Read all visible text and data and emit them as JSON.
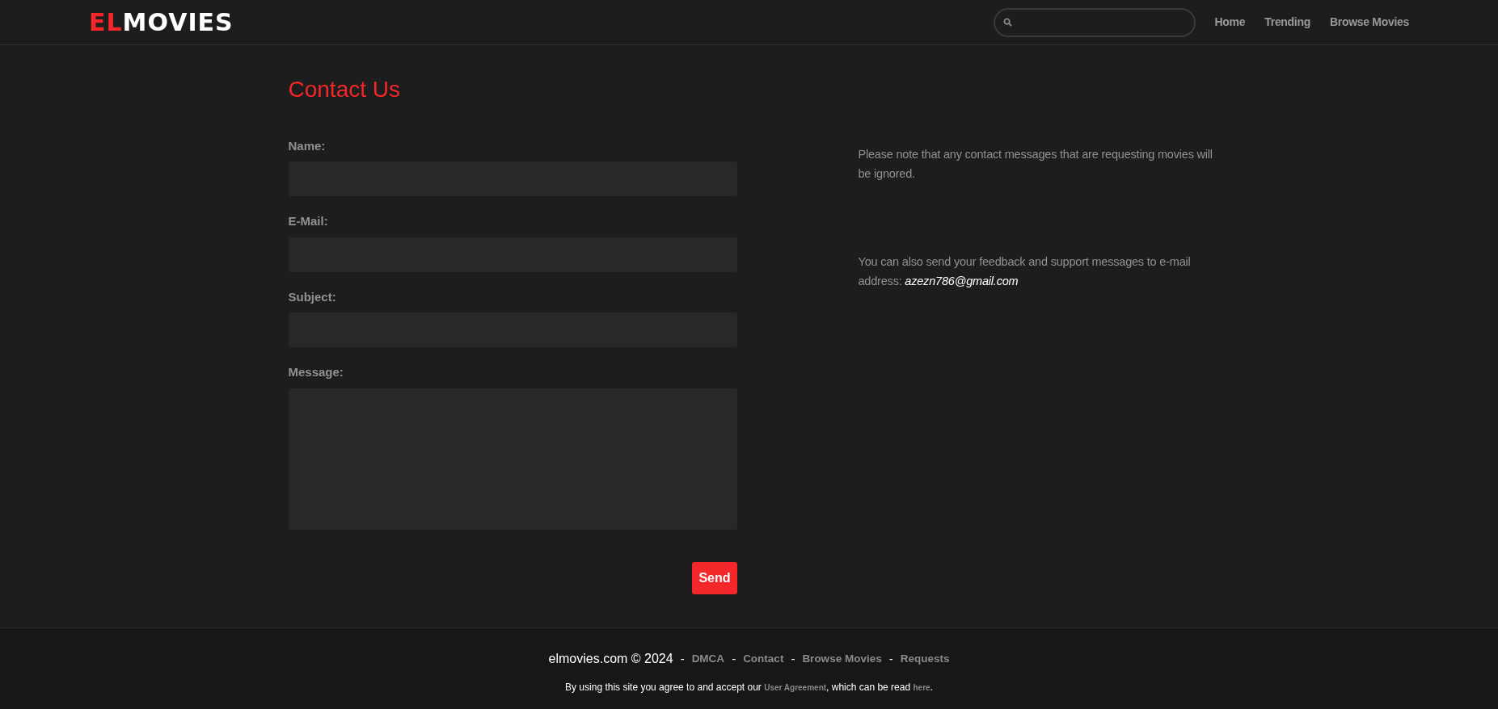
{
  "header": {
    "logo": {
      "accent": "EL",
      "rest": "MOVIES"
    },
    "nav": [
      {
        "label": "Home"
      },
      {
        "label": "Trending"
      },
      {
        "label": "Browse Movies"
      }
    ]
  },
  "contact": {
    "title": "Contact Us",
    "fields": [
      {
        "label": "Name:",
        "kind": "input"
      },
      {
        "label": "E-Mail:",
        "kind": "input"
      },
      {
        "label": "Subject:",
        "kind": "input"
      },
      {
        "label": "Message:",
        "kind": "textarea"
      }
    ],
    "submit": "Send",
    "notes": [
      "Please note that any contact messages that are requesting movies will be ignored.",
      "You can also send your feedback and support messages to e-mail address: *azezn786@gmail.com*"
    ]
  },
  "footer": {
    "site": "elmovies.com © 2024",
    "separator": "-",
    "links": [
      "DMCA",
      "Contact",
      "Browse Movies",
      "Requests"
    ],
    "agreement": {
      "before": "By using this site you agree to and accept our ",
      "link": "User Agreement",
      "middle": ", which can be read ",
      "link2": "here",
      "after": "."
    }
  }
}
